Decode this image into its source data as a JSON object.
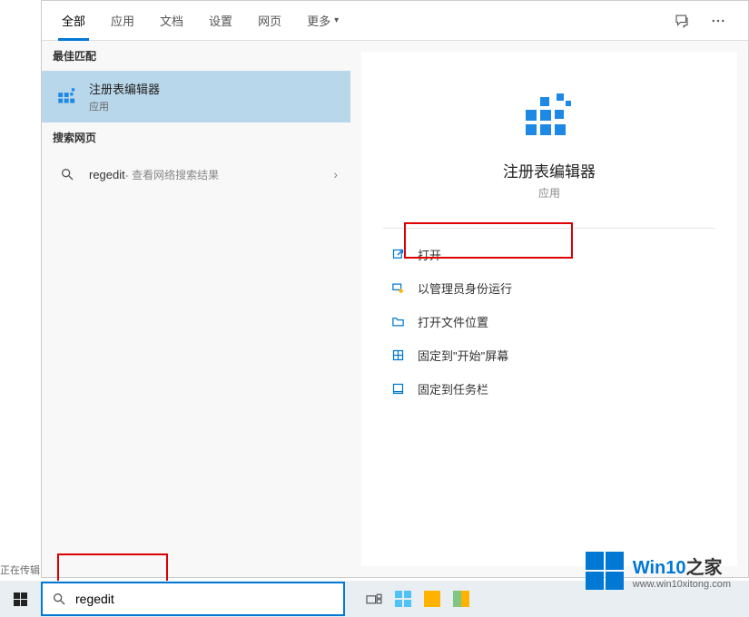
{
  "tabs": {
    "items": [
      "全部",
      "应用",
      "文档",
      "设置",
      "网页",
      "更多"
    ],
    "active_index": 0
  },
  "left": {
    "best_match_header": "最佳匹配",
    "best_match": {
      "title": "注册表编辑器",
      "sub": "应用"
    },
    "web_header": "搜索网页",
    "web_item": {
      "query": "regedit",
      "suffix": " - 查看网络搜索结果"
    }
  },
  "right": {
    "title": "注册表编辑器",
    "sub": "应用",
    "actions": [
      "打开",
      "以管理员身份运行",
      "打开文件位置",
      "固定到\"开始\"屏幕",
      "固定到任务栏"
    ]
  },
  "status": "正在传辑",
  "search_value": "regedit",
  "watermark": {
    "brand": "Win10",
    "suffix": "之家",
    "url": "www.win10xitong.com"
  }
}
